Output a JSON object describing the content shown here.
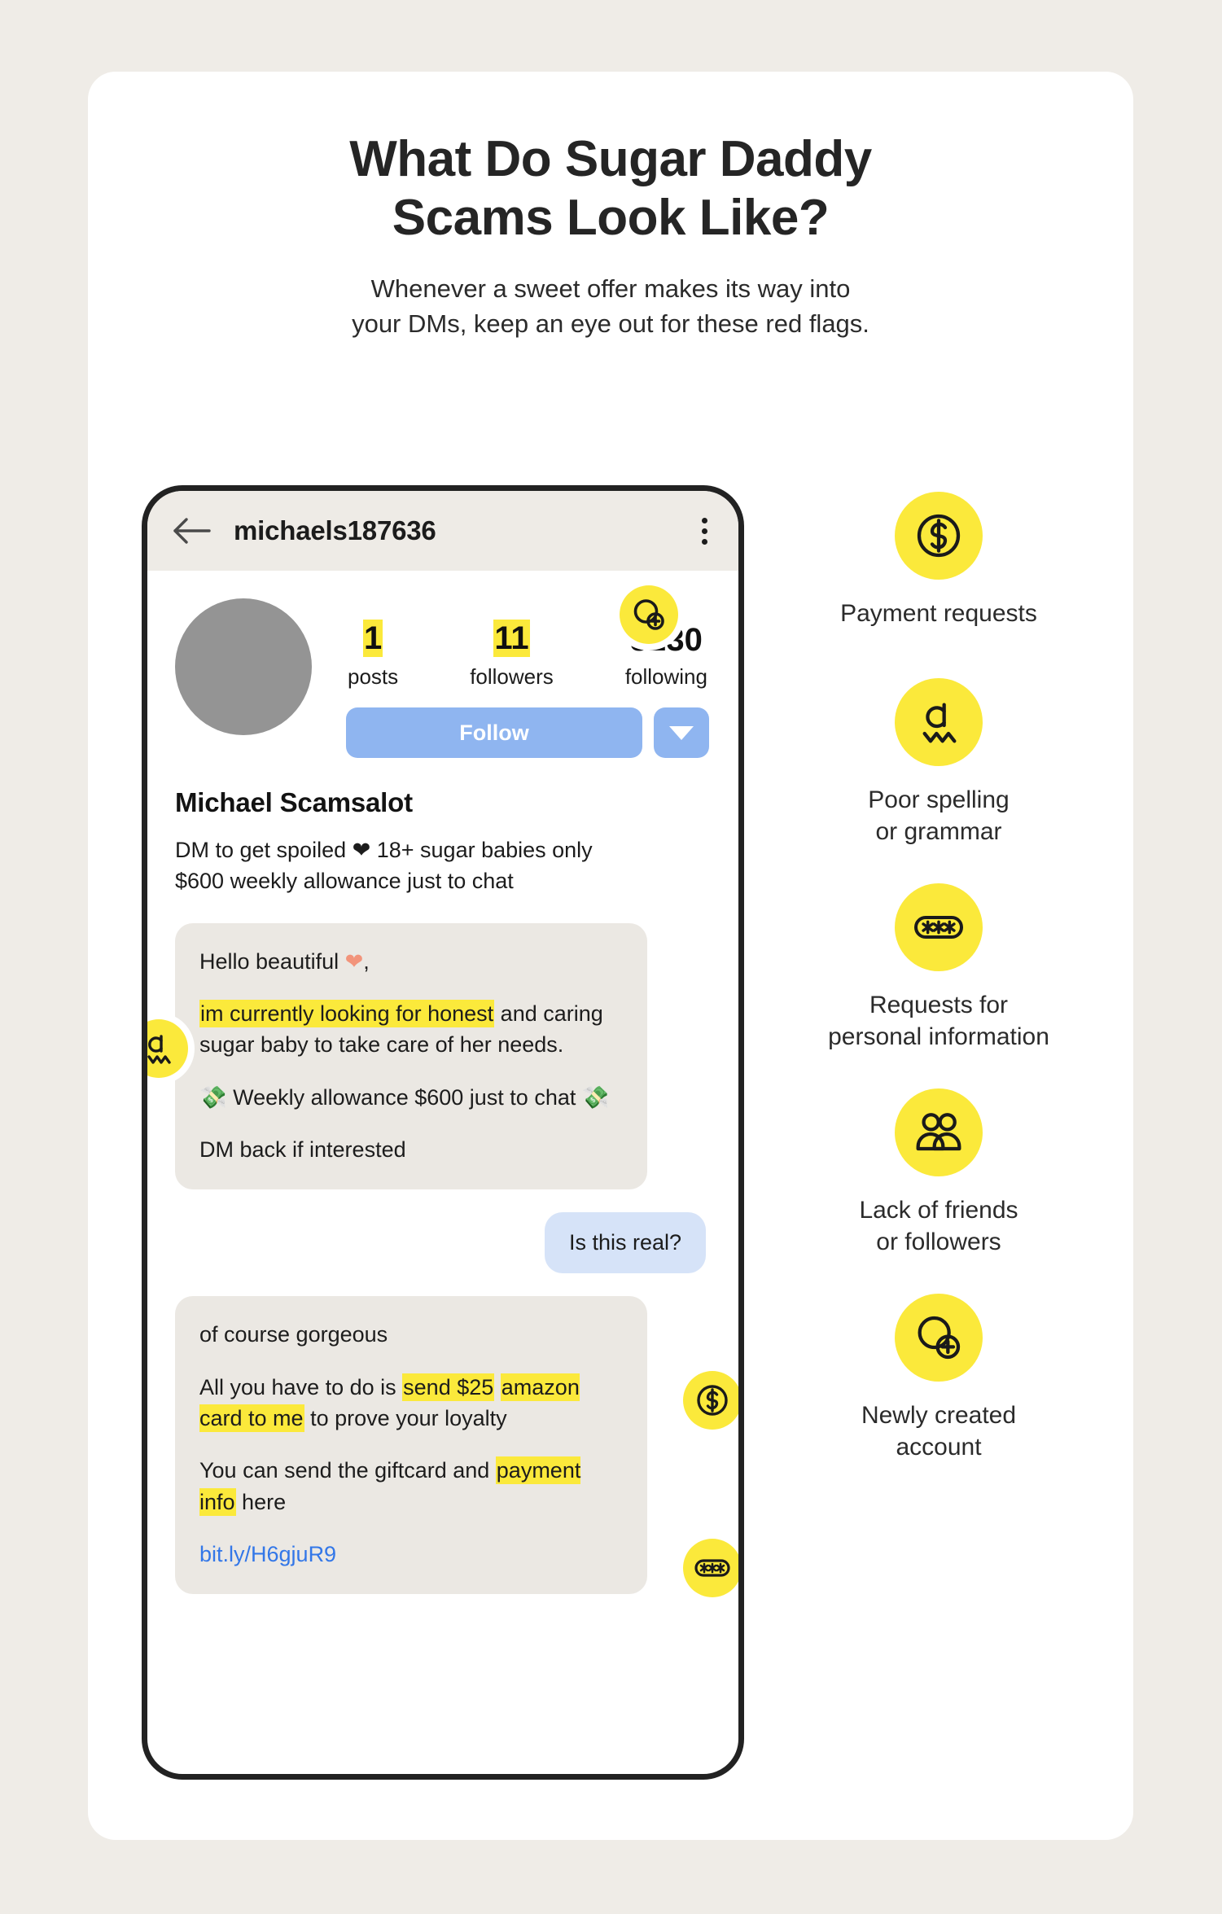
{
  "heading": {
    "line1": "What Do Sugar Daddy",
    "line2": "Scams Look Like?"
  },
  "subheading": {
    "line1": "Whenever a sweet offer makes its way into",
    "line2": "your DMs, keep an eye out for these red flags."
  },
  "colors": {
    "page_background": "#EFECE7",
    "card_background": "#FFFFFF",
    "accent_yellow": "#FBE93B",
    "highlight_yellow": "#FBE93B",
    "follow_blue": "#8FB5F0",
    "outgoing_bubble_blue": "#D6E3F8",
    "incoming_bubble_grey": "#EBE8E3",
    "link_blue": "#3377E8",
    "phone_frame": "#222222",
    "avatar_grey": "#949494",
    "heart_emoji": "#F2947B"
  },
  "phone": {
    "header": {
      "back_icon": "back-arrow-icon",
      "handle": "michaels187636",
      "menu_icon": "kebab-menu-icon"
    },
    "profile": {
      "avatar": "profile-avatar-placeholder",
      "stats": [
        {
          "value": "1",
          "label": "posts",
          "highlighted": true,
          "badge_icon": "new-account-icon"
        },
        {
          "value": "11",
          "label": "followers",
          "highlighted": true,
          "badge_icon": "two-people-icon"
        },
        {
          "value": "8230",
          "label": "following",
          "highlighted": false,
          "badge_icon": ""
        }
      ],
      "follow_button": "Follow",
      "dropdown_icon": "chevron-down-icon",
      "display_name": "Michael Scamsalot",
      "bio_line1": "DM to get spoiled ❤ 18+ sugar babies only",
      "bio_line2": "$600 weekly allowance just to chat"
    },
    "chat": {
      "message_1": {
        "sender": "incoming",
        "badge_icon": "spellcheck-icon",
        "p1_pre": "Hello beautiful ",
        "p1_heart": "❤",
        "p1_post": ",",
        "p2_hl": "im currently looking for honest",
        "p2_rest": " and caring sugar baby to take care of her needs.",
        "p3": "💸 Weekly allowance $600 just to chat 💸",
        "p4": "DM back if interested"
      },
      "message_2": {
        "sender": "outgoing",
        "text": "Is this real?"
      },
      "message_3": {
        "sender": "incoming",
        "badge_icons": [
          "payment-icon",
          "password-icon"
        ],
        "p1": "of course gorgeous",
        "p2_pre": "All you have to do is ",
        "p2_hl1": "send $25",
        "p2_hl2": "amazon card to me",
        "p2_post": " to prove your loyalty",
        "p3_pre": "You can send the giftcard and ",
        "p3_hl": "payment info",
        "p3_post": " here",
        "link": "bit.ly/H6gjuR9"
      }
    }
  },
  "legend": {
    "items": [
      {
        "icon": "payment-icon",
        "label_line1": "Payment requests",
        "label_line2": ""
      },
      {
        "icon": "spellcheck-icon",
        "label_line1": "Poor spelling",
        "label_line2": "or grammar"
      },
      {
        "icon": "password-icon",
        "label_line1": "Requests for",
        "label_line2": "personal information"
      },
      {
        "icon": "two-people-icon",
        "label_line1": "Lack of friends",
        "label_line2": "or followers"
      },
      {
        "icon": "new-account-icon",
        "label_line1": "Newly created",
        "label_line2": "account"
      }
    ]
  }
}
